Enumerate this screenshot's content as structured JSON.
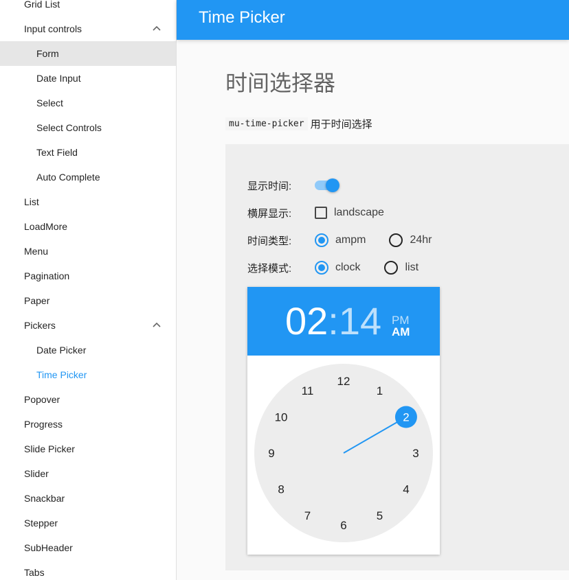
{
  "sidebar": {
    "items": [
      {
        "label": "Grid List",
        "level": "top"
      },
      {
        "label": "Input controls",
        "level": "top",
        "expanded": true
      },
      {
        "label": "Form",
        "level": "sub",
        "highlighted": true
      },
      {
        "label": "Date Input",
        "level": "sub"
      },
      {
        "label": "Select",
        "level": "sub"
      },
      {
        "label": "Select Controls",
        "level": "sub"
      },
      {
        "label": "Text Field",
        "level": "sub"
      },
      {
        "label": "Auto Complete",
        "level": "sub"
      },
      {
        "label": "List",
        "level": "top"
      },
      {
        "label": "LoadMore",
        "level": "top"
      },
      {
        "label": "Menu",
        "level": "top"
      },
      {
        "label": "Pagination",
        "level": "top"
      },
      {
        "label": "Paper",
        "level": "top"
      },
      {
        "label": "Pickers",
        "level": "top",
        "expanded": true
      },
      {
        "label": "Date Picker",
        "level": "sub"
      },
      {
        "label": "Time Picker",
        "level": "sub",
        "selected": true
      },
      {
        "label": "Popover",
        "level": "top"
      },
      {
        "label": "Progress",
        "level": "top"
      },
      {
        "label": "Slide Picker",
        "level": "top"
      },
      {
        "label": "Slider",
        "level": "top"
      },
      {
        "label": "Snackbar",
        "level": "top"
      },
      {
        "label": "Stepper",
        "level": "top"
      },
      {
        "label": "SubHeader",
        "level": "top"
      },
      {
        "label": "Tabs",
        "level": "top"
      }
    ]
  },
  "appbar": {
    "title": "Time Picker"
  },
  "page": {
    "heading": "时间选择器",
    "desc_code": "mu-time-picker",
    "desc_text": "用于时间选择"
  },
  "form": {
    "show_time": {
      "label": "显示时间:",
      "on": true
    },
    "landscape": {
      "label": "横屏显示:",
      "option": "landscape",
      "checked": false
    },
    "time_type": {
      "label": "时间类型:",
      "options": [
        "ampm",
        "24hr"
      ],
      "selected": "ampm"
    },
    "mode": {
      "label": "选择模式:",
      "options": [
        "clock",
        "list"
      ],
      "selected": "clock"
    }
  },
  "picker": {
    "hour": "02",
    "separator": ":",
    "minute": "14",
    "pm": "PM",
    "am": "AM",
    "selected_hour": 2,
    "numbers": [
      "12",
      "1",
      "2",
      "3",
      "4",
      "5",
      "6",
      "7",
      "8",
      "9",
      "10",
      "11"
    ]
  },
  "colors": {
    "accent": "#2196f3",
    "accent_light": "#90caf9",
    "clock_bg": "#ededed"
  }
}
